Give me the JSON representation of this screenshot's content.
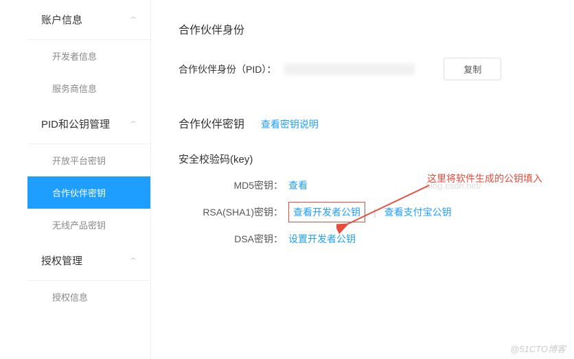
{
  "sidebar": {
    "group1": {
      "title": "账户信息",
      "items": [
        "开发者信息",
        "服务商信息"
      ]
    },
    "group2": {
      "title": "PID和公钥管理",
      "items": [
        "开放平台密钥",
        "合作伙伴密钥",
        "无线产品密钥"
      ]
    },
    "group3": {
      "title": "授权管理",
      "items": [
        "授权信息"
      ]
    }
  },
  "main": {
    "identity_title": "合作伙伴身份",
    "pid_label": "合作伙伴身份（PID）：",
    "copy_btn": "复制",
    "key_title": "合作伙伴密钥",
    "key_help": "查看密钥说明",
    "key_subtitle": "安全校验码(key)",
    "md5_label": "MD5密钥：",
    "md5_link": "查看",
    "rsa_label": "RSA(SHA1)密钥：",
    "rsa_link1": "查看开发者公钥",
    "rsa_link2": "查看支付宝公钥",
    "dsa_label": "DSA密钥：",
    "dsa_link": "设置开发者公钥",
    "ghost_text": "blog.csdn.net/"
  },
  "annotation": "这里将软件生成的公钥填入",
  "footer_watermark": "@51CTO博客"
}
